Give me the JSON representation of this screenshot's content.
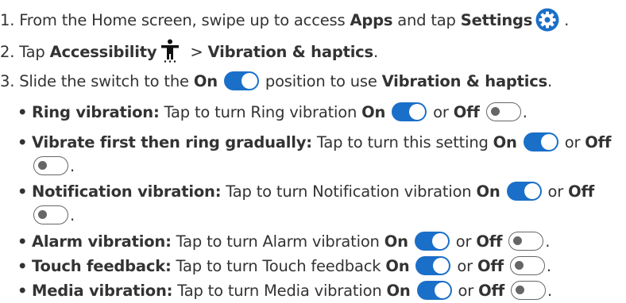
{
  "steps": [
    {
      "prefix": "1. From the Home screen, swipe up to access ",
      "bold1": "Apps",
      "mid": " and tap ",
      "bold2": "Settings",
      "suffix": " ."
    },
    {
      "prefix": "2. Tap ",
      "bold1": "Accessibility",
      "mid": " > ",
      "bold2": "Vibration & haptics",
      "suffix": "."
    },
    {
      "prefix": "3. Slide the switch to the ",
      "bold1": "On",
      "mid": " position to use ",
      "bold2": "Vibration & haptics",
      "suffix": "."
    }
  ],
  "bullet_char": "•",
  "items": [
    {
      "title": "Ring vibration:",
      "text": " Tap to turn Ring vibration ",
      "on": "On",
      "or": " or ",
      "off": "Off",
      "end": "."
    },
    {
      "title": "Vibrate first then ring gradually:",
      "text": " Tap to turn this setting ",
      "on": "On",
      "or": " or ",
      "off": "Off",
      "end": "."
    },
    {
      "title": "Notification vibration:",
      "text": " Tap to turn Notification vibration ",
      "on": "On",
      "or": " or ",
      "off": "Off",
      "end": "."
    },
    {
      "title": "Alarm vibration:",
      "text": " Tap to turn Alarm vibration ",
      "on": "On",
      "or": " or ",
      "off": "Off",
      "end": "."
    },
    {
      "title": "Touch feedback:",
      "text": " Tap to turn Touch feedback ",
      "on": "On",
      "or": " or ",
      "off": "Off",
      "end": "."
    },
    {
      "title": "Media vibration:",
      "text": " Tap to turn Media vibration ",
      "on": "On",
      "or": " or ",
      "off": "Off",
      "end": "."
    }
  ],
  "icons": {
    "settings": "settings-gear-icon",
    "accessibility": "accessibility-person-icon",
    "toggle_on": "toggle-on-icon",
    "toggle_off": "toggle-off-icon"
  },
  "colors": {
    "text": "#333333",
    "toggle_on": "#1a6fc8",
    "toggle_off_border": "#666666"
  }
}
